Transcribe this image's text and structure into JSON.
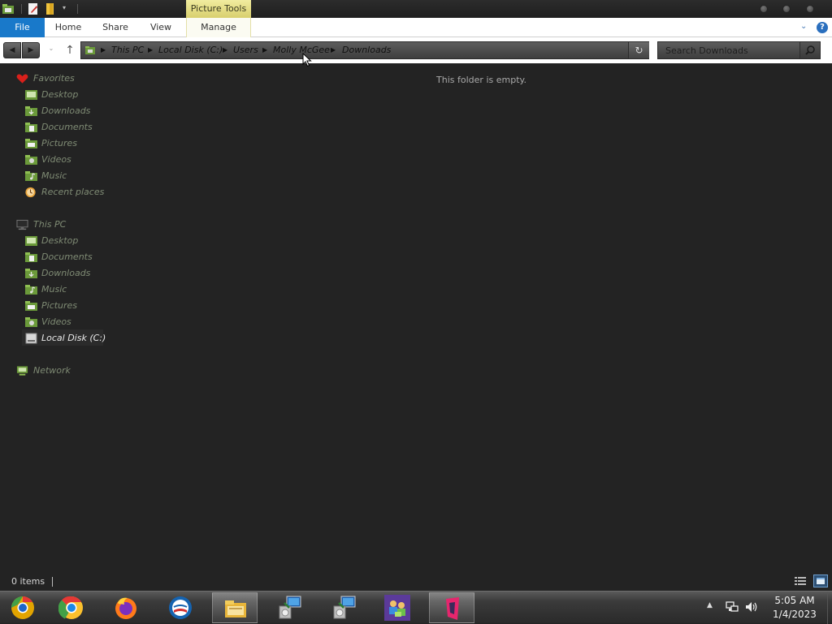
{
  "titlebar": {
    "contextual_tab_group": "Picture Tools"
  },
  "ribbon": {
    "tabs": [
      {
        "label": "File"
      },
      {
        "label": "Home"
      },
      {
        "label": "Share"
      },
      {
        "label": "View"
      },
      {
        "label": "Manage"
      }
    ],
    "help_label": "?"
  },
  "address": {
    "breadcrumbs": [
      "This PC",
      "Local Disk (C:)",
      "Users",
      "Molly McGee",
      "Downloads"
    ]
  },
  "search": {
    "placeholder": "Search Downloads"
  },
  "nav": {
    "favorites": {
      "label": "Favorites",
      "items": [
        "Desktop",
        "Downloads",
        "Documents",
        "Pictures",
        "Videos",
        "Music",
        "Recent places"
      ]
    },
    "this_pc": {
      "label": "This PC",
      "items": [
        "Desktop",
        "Documents",
        "Downloads",
        "Music",
        "Pictures",
        "Videos",
        "Local Disk (C:)"
      ],
      "selected": "Local Disk (C:)"
    },
    "network": {
      "label": "Network"
    }
  },
  "content": {
    "empty_message": "This folder is empty."
  },
  "status": {
    "item_count": "0 items"
  },
  "taskbar": {
    "apps": [
      "chrome-canary-icon",
      "chrome-icon",
      "firefox-icon",
      "campaign-o-icon",
      "file-explorer-icon",
      "remote-setup-icon",
      "remote-setup-icon-2",
      "users-group-icon",
      "pink-app-icon"
    ],
    "time": "5:05 AM",
    "date": "1/4/2023"
  },
  "colors": {
    "file_tab": "#1979ca",
    "picture_tools": "#e8e28a",
    "window_bg": "#232323",
    "nav_text": "#7f8b74"
  }
}
